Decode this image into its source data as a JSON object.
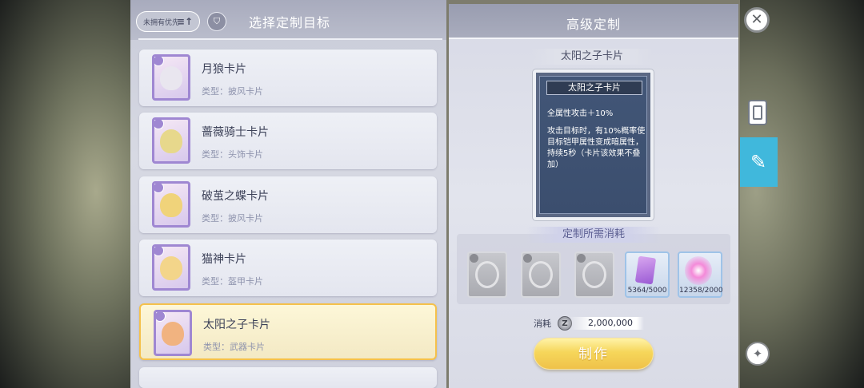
{
  "left": {
    "sort_label": "未拥有优先",
    "sort_icon": "≡↑",
    "filter_icon": "⛉",
    "title": "选择定制目标",
    "cards": [
      {
        "name": "月狼卡片",
        "type": "类型：披风卡片",
        "selected": false,
        "face": "#e9e6ef"
      },
      {
        "name": "蔷薇骑士卡片",
        "type": "类型：头饰卡片",
        "selected": false,
        "face": "#e7d88c"
      },
      {
        "name": "破茧之蝶卡片",
        "type": "类型：披风卡片",
        "selected": false,
        "face": "#f0d37a"
      },
      {
        "name": "猫神卡片",
        "type": "类型：盔甲卡片",
        "selected": false,
        "face": "#f3d58a"
      },
      {
        "name": "太阳之子卡片",
        "type": "类型：武器卡片",
        "selected": true,
        "face": "#f1b380"
      }
    ]
  },
  "right": {
    "title": "高级定制",
    "card_label": "太阳之子卡片",
    "card": {
      "name": "太阳之子卡片",
      "effect": "全属性攻击＋10%",
      "desc": "攻击目标时，有10%概率使目标铠甲属性变成暗属性，持续5秒（卡片该效果不叠加）"
    },
    "cost_title": "定制所需消耗",
    "materials": [
      {
        "icon": "mask-icon",
        "count": "",
        "lit": false
      },
      {
        "icon": "flame-icon",
        "count": "",
        "lit": false
      },
      {
        "icon": "swirl-icon",
        "count": "",
        "lit": false
      },
      {
        "icon": "purple-card-icon",
        "count": "5364/5000",
        "lit": true
      },
      {
        "icon": "pink-orb-icon",
        "count": "12358/2000",
        "lit": true
      }
    ],
    "consume_label": "消耗",
    "consume_value": "2,000,000",
    "zeny_symbol": "Z",
    "make_button": "制作"
  },
  "side": {
    "close": "✕",
    "wand": "✦"
  },
  "colors": {
    "accent_blue": "#40b8dc",
    "selected_border": "#f5c14b",
    "portrait_border": "#9f87d2"
  }
}
